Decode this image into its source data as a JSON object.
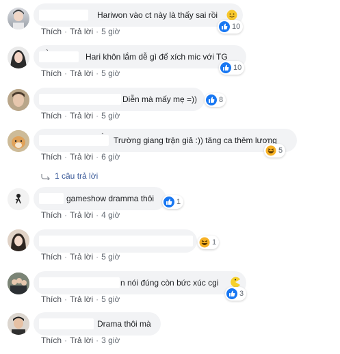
{
  "actions": {
    "like": "Thích",
    "reply": "Trả lời",
    "sep": "·"
  },
  "colors": {
    "like_blue": "#1877f2",
    "haha_yellow": "#f7b125",
    "bubble_bg": "#f2f3f5"
  },
  "comments": [
    {
      "text": "Hariwon vào ct này là thấy sai rồi",
      "emoji": "slightly-smiling-face",
      "reaction": "like-icon",
      "count": "10",
      "time": "5 giờ"
    },
    {
      "prefix": "`",
      "text": "Hari khôn lắm dễ gì để xích mic với TG",
      "reaction": "like-icon",
      "count": "10",
      "time": "5 giờ"
    },
    {
      "text": "Diễn mà mấy mẹ =))",
      "reaction": "like-icon",
      "count": "8",
      "time": "5 giờ"
    },
    {
      "prefix": "`",
      "text": "Trường giang trận giả :)) tăng ca thêm lương",
      "reaction": "haha-icon",
      "count": "5",
      "time": "6 giờ"
    },
    {
      "text": "gameshow dramma thôi",
      "reaction": "like-icon",
      "count": "1",
      "time": "4 giờ"
    },
    {
      "text": "",
      "reaction": "haha-icon",
      "count": "1",
      "time": "5 giờ"
    },
    {
      "text": "n nói đúng còn bức xúc cgi",
      "emoji": "pacman-emoji",
      "reaction": "like-icon",
      "count": "3",
      "time": "5 giờ"
    },
    {
      "text": "Drama thôi mà",
      "time": "3 giờ"
    }
  ],
  "replies_link": "1 câu trả lời"
}
